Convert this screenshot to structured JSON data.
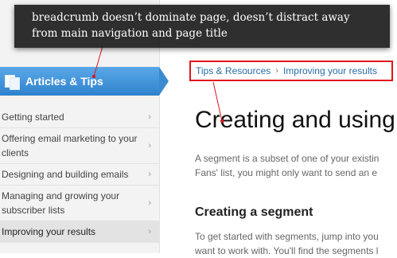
{
  "annotation": {
    "line1": "breadcrumb doesn’t dominate page, doesn’t distract away",
    "line2": "from main navigation and page title"
  },
  "sidebar": {
    "header": "Articles & Tips",
    "items": [
      {
        "label": "Getting started"
      },
      {
        "label": "Offering email marketing to your clients"
      },
      {
        "label": "Designing and building emails"
      },
      {
        "label": "Managing and growing your subscriber lists"
      },
      {
        "label": "Improving your results",
        "active": true
      }
    ],
    "chevron": "›"
  },
  "breadcrumb": {
    "items": [
      "Tips & Resources",
      "Improving your results"
    ],
    "separator": "›"
  },
  "main": {
    "title": "Creating and using",
    "intro_line1": "A segment is a subset of one of your existin",
    "intro_line2": "Fans' list, you might only want to send an e",
    "section_title": "Creating a segment",
    "body_line1": "To get started with segments, jump into you",
    "body_line2": "want to work with. You'll find the segments l"
  },
  "colors": {
    "highlight_border": "#e0141c",
    "sidebar_header": "#3a8ad2",
    "link": "#2a6ea8"
  }
}
